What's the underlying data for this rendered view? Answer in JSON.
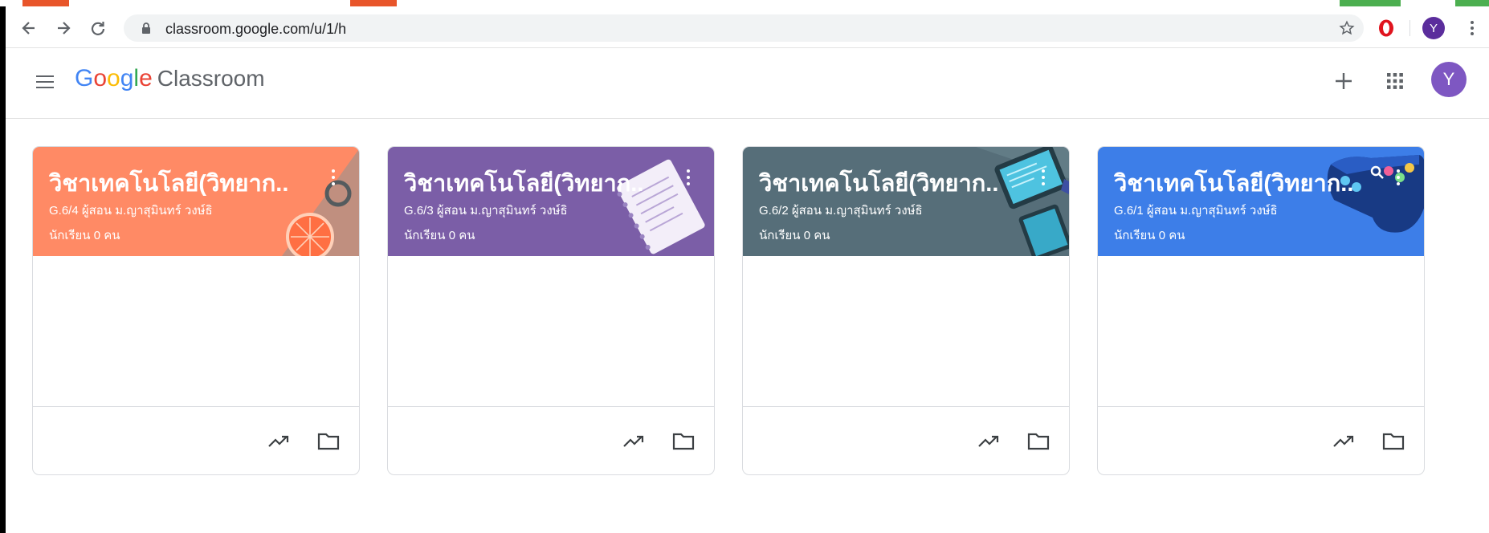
{
  "browser": {
    "url": "classroom.google.com/u/1/h",
    "profile_initial": "Y"
  },
  "header": {
    "brand_google": [
      "G",
      "o",
      "o",
      "g",
      "l",
      "e"
    ],
    "brand_product": "Classroom",
    "avatar_initial": "Y"
  },
  "classes": [
    {
      "title": "วิชาเทคโนโลยี(วิทยาก...",
      "subtitle": "G.6/4 ผู้สอน ม.ญาสุมินทร์ วงษ์ธิ",
      "students": "นักเรียน 0 คน",
      "color": "#ff8a65",
      "art": "citrus"
    },
    {
      "title": "วิชาเทคโนโลยี(วิทยาก...",
      "subtitle": "G.6/3 ผู้สอน ม.ญาสุมินทร์ วงษ์ธิ",
      "students": "นักเรียน 0 คน",
      "color": "#7b5ea7",
      "art": "notebook"
    },
    {
      "title": "วิชาเทคโนโลยี(วิทยาก...",
      "subtitle": "G.6/2 ผู้สอน ม.ญาสุมินทร์ วงษ์ธิ",
      "students": "นักเรียน 0 คน",
      "color": "#566e79",
      "art": "tablets"
    },
    {
      "title": "วิชาเทคโนโลยี(วิทยาก...",
      "subtitle": "G.6/1 ผู้สอน ม.ญาสุมินทร์ วงษ์ธิ",
      "students": "นักเรียน 0 คน",
      "color": "#3d7ee8",
      "art": "gamepad"
    }
  ],
  "card_footer_icons": [
    "trending-up-icon",
    "folder-icon"
  ]
}
